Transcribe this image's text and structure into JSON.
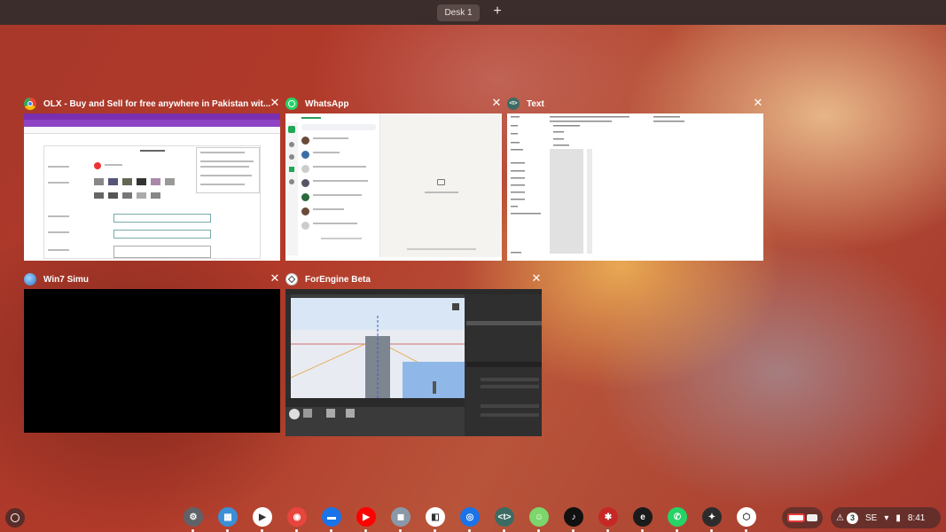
{
  "topbar": {
    "desk_label": "Desk 1",
    "new_desk_label": "+"
  },
  "windows": [
    {
      "title": "OLX - Buy and Sell for free anywhere in Pakistan wit...",
      "icon": "chrome-icon",
      "close": "✕"
    },
    {
      "title": "WhatsApp",
      "icon": "whatsapp-icon",
      "close": "✕"
    },
    {
      "title": "Text",
      "icon": "text-app-icon",
      "close": "✕"
    },
    {
      "title": "Win7 Simu",
      "icon": "win7-simu-icon",
      "close": "✕"
    },
    {
      "title": "ForEngine Beta",
      "icon": "forengine-icon",
      "close": "✕"
    }
  ],
  "shelf": {
    "apps": [
      {
        "name": "settings-icon",
        "color": "#5f6368",
        "glyph": "⚙"
      },
      {
        "name": "win7-simu-icon",
        "color": "#3b8fd6",
        "glyph": "▦"
      },
      {
        "name": "play-store-icon",
        "color": "#ffffff",
        "glyph": "▶"
      },
      {
        "name": "chrome-icon",
        "color": "#e8453c",
        "glyph": "◉"
      },
      {
        "name": "files-icon",
        "color": "#1a73e8",
        "glyph": "▬"
      },
      {
        "name": "youtube-icon",
        "color": "#ff0000",
        "glyph": "▶"
      },
      {
        "name": "robot-app-icon",
        "color": "#8a99a8",
        "glyph": "◼"
      },
      {
        "name": "media-app-icon",
        "color": "#ffffff",
        "glyph": "◧"
      },
      {
        "name": "camera-icon",
        "color": "#1a73e8",
        "glyph": "◎"
      },
      {
        "name": "text-app-icon",
        "color": "#3c6b63",
        "glyph": "<t>"
      },
      {
        "name": "game-app-icon",
        "color": "#7bd66b",
        "glyph": "☺"
      },
      {
        "name": "tiktok-icon",
        "color": "#111111",
        "glyph": "♪"
      },
      {
        "name": "spider-app-icon",
        "color": "#c62828",
        "glyph": "✱"
      },
      {
        "name": "e-app-icon",
        "color": "#1b1b1b",
        "glyph": "e"
      },
      {
        "name": "whatsapp-icon",
        "color": "#25d366",
        "glyph": "✆"
      },
      {
        "name": "shadow-app-icon",
        "color": "#2c2c2c",
        "glyph": "✦"
      },
      {
        "name": "forengine-icon",
        "color": "#ffffff",
        "glyph": "⬡"
      }
    ],
    "tray": {
      "notification_count": "3",
      "locale": "SE",
      "time": "8:41"
    }
  }
}
